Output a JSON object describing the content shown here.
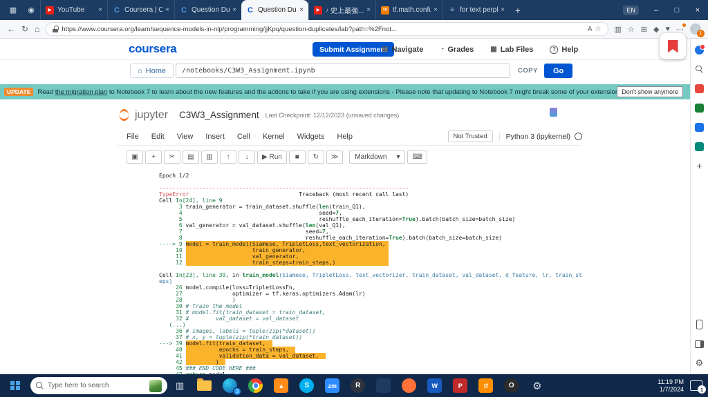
{
  "colors": {
    "accent_blue": "#0056d2",
    "jupyter_orange": "#f37726",
    "banner_teal": "#74cac3",
    "highlight_orange": "#fcb32c"
  },
  "browser": {
    "tab_actions_icon": "▦",
    "pinned_icon": "◉",
    "tabs": [
      {
        "label": "YouTube",
        "icon": "youtube"
      },
      {
        "label": "Coursera | Onli...",
        "icon": "coursera"
      },
      {
        "label": "Question Dupli...",
        "icon": "coursera"
      },
      {
        "label": "Question Dupli...",
        "icon": "coursera",
        "active": true
      },
      {
        "label": "史上最強...",
        "icon": "youtube",
        "audio": true
      },
      {
        "label": "tf.math.confusi...",
        "icon": "tensorflow"
      },
      {
        "label": "for text perplex...",
        "icon": "page"
      }
    ],
    "new_tab_label": "+",
    "language_badge": "EN",
    "minimize": "–",
    "maximize": "□",
    "close": "×",
    "back_icon": "←",
    "refresh_icon": "↻",
    "home_icon": "⌂",
    "url": "https://www.coursera.org/learn/sequence-models-in-nlp/programming/jjKpq/question-duplicates/lab?path=%2Fnot...",
    "read_aloud_icon": "A",
    "favorite_icon": "☆",
    "toolbar_icons": [
      {
        "n": "split-screen-icon",
        "g": "▥"
      },
      {
        "n": "favorites-icon",
        "g": "☆"
      },
      {
        "n": "collections-icon",
        "g": "⊞"
      },
      {
        "n": "extensions-icon",
        "g": "◆"
      },
      {
        "n": "browser-essentials-icon",
        "g": "♥"
      },
      {
        "n": "settings-more-icon",
        "g": "⋯",
        "dot": true
      }
    ],
    "profile_badge": "1"
  },
  "coursera": {
    "logo": "coursera",
    "submit": "Submit Assignment",
    "nav_items": [
      {
        "n": "navigate-button",
        "icon": "▤",
        "label": "Navigate"
      },
      {
        "n": "grades-button",
        "icon": "◔",
        "label": "Grades"
      },
      {
        "n": "lab-files-button",
        "icon": "▦",
        "label": "Lab Files"
      },
      {
        "n": "help-button",
        "icon": "?",
        "label": "Help",
        "qmark": true
      }
    ],
    "home": "Home",
    "home_icon": "⌂",
    "path": "/notebooks/C3W3_Assignment.ipynb",
    "copy": "COPY",
    "go": "Go"
  },
  "banner": {
    "badge": "UPDATE",
    "pre": "Read ",
    "link": "the migration plan",
    "post": " to Notebook 7 to learn about the new features and the actions to take if you are using extensions - Please note that updating to Notebook 7 might break some of your extensions.",
    "dismiss": "Don't show anymore"
  },
  "jupyter": {
    "brand": "jupyter",
    "title": "C3W3_Assignment",
    "checkpoint": "Last Checkpoint: 12/12/2023",
    "unsaved": "(unsaved changes)",
    "menus": [
      "File",
      "Edit",
      "View",
      "Insert",
      "Cell",
      "Kernel",
      "Widgets",
      "Help"
    ],
    "not_trusted": "Not Trusted",
    "kernel_name": "Python 3 (ipykernel)",
    "cell_type": "Markdown",
    "caret": "▾",
    "keyboard_icon": "⌨",
    "toolbar": [
      {
        "n": "save-button",
        "g": "▣"
      },
      {
        "n": "insert-cell-button",
        "g": "+"
      },
      {
        "n": "cut-cells-button",
        "g": "✂"
      },
      {
        "n": "copy-cells-button",
        "g": "▤"
      },
      {
        "n": "paste-cells-button",
        "g": "▥"
      },
      {
        "n": "move-cell-up-button",
        "g": "↑"
      },
      {
        "n": "move-cell-down-button",
        "g": "↓"
      },
      {
        "n": "run-button",
        "g": "▶ Run"
      },
      {
        "n": "interrupt-kernel-button",
        "g": "■"
      },
      {
        "n": "restart-kernel-button",
        "g": "↻"
      },
      {
        "n": "restart-run-all-button",
        "g": "≫"
      }
    ]
  },
  "code": {
    "lines": [
      {
        "s": [
          {
            "t": "Epoch 1/2",
            "c": "p"
          }
        ]
      },
      {
        "s": []
      },
      {
        "s": [
          {
            "t": "---------------------------------------------------------------------------",
            "c": "r"
          }
        ]
      },
      {
        "s": [
          {
            "t": "TypeError",
            "c": "r"
          },
          {
            "t": "                                 Traceback (most recent call last)",
            "c": "p"
          }
        ]
      },
      {
        "s": [
          {
            "t": "Cell ",
            "c": "p"
          },
          {
            "t": "In[24], line 9",
            "c": "g"
          }
        ]
      },
      {
        "s": [
          {
            "t": "      3 ",
            "c": "g"
          },
          {
            "t": "train_generator = train_dataset.shuffle(",
            "c": "p"
          },
          {
            "t": "len",
            "c": "k"
          },
          {
            "t": "(train_Q1),",
            "c": "p"
          }
        ]
      },
      {
        "s": [
          {
            "t": "      4 ",
            "c": "g"
          },
          {
            "t": "                                        seed=",
            "c": "p"
          },
          {
            "t": "7",
            "c": "k"
          },
          {
            "t": ",",
            "c": "p"
          }
        ]
      },
      {
        "s": [
          {
            "t": "      5 ",
            "c": "g"
          },
          {
            "t": "                                        reshuffle_each_iteration=",
            "c": "p"
          },
          {
            "t": "True",
            "c": "k"
          },
          {
            "t": ").batch(batch_size=batch_size)",
            "c": "p"
          }
        ]
      },
      {
        "s": [
          {
            "t": "      6 ",
            "c": "g"
          },
          {
            "t": "val_generator = val_dataset.shuffle(",
            "c": "p"
          },
          {
            "t": "len",
            "c": "k"
          },
          {
            "t": "(val_Q1),",
            "c": "p"
          }
        ]
      },
      {
        "s": [
          {
            "t": "      7 ",
            "c": "g"
          },
          {
            "t": "                                    seed=",
            "c": "p"
          },
          {
            "t": "7",
            "c": "k"
          },
          {
            "t": ",",
            "c": "p"
          }
        ]
      },
      {
        "s": [
          {
            "t": "      8 ",
            "c": "g"
          },
          {
            "t": "                                    reshuffle_each_iteration=",
            "c": "p"
          },
          {
            "t": "True",
            "c": "k"
          },
          {
            "t": ").batch(batch_size=batch_size)",
            "c": "p"
          }
        ]
      },
      {
        "s": [
          {
            "t": "----> 9 ",
            "c": "g"
          },
          {
            "t": "model = train_model(Siamese, TripletLoss,text_vectorization, ",
            "c": "h"
          }
        ]
      },
      {
        "s": [
          {
            "t": "     10 ",
            "c": "g"
          },
          {
            "t": "                    train_generator,                         ",
            "c": "h"
          }
        ]
      },
      {
        "s": [
          {
            "t": "     11 ",
            "c": "g"
          },
          {
            "t": "                    val_generator,                           ",
            "c": "h"
          }
        ]
      },
      {
        "s": [
          {
            "t": "     12 ",
            "c": "g"
          },
          {
            "t": "                    train_steps=train_steps,)                ",
            "c": "h"
          }
        ]
      },
      {
        "s": []
      },
      {
        "s": [
          {
            "t": "Cell ",
            "c": "p"
          },
          {
            "t": "In[23], line 39",
            "c": "g"
          },
          {
            "t": ", in ",
            "c": "p"
          },
          {
            "t": "train_model",
            "c": "k"
          },
          {
            "t": "(Siamese, TripletLoss, text_vectorizer, train_dataset, val_dataset, d_feature, lr, train_st",
            "c": "sig"
          }
        ]
      },
      {
        "s": [
          {
            "t": "eps)",
            "c": "sig"
          }
        ]
      },
      {
        "s": [
          {
            "t": "     26 ",
            "c": "g"
          },
          {
            "t": "model.compile(loss=TripletLossFn,",
            "c": "p"
          }
        ]
      },
      {
        "s": [
          {
            "t": "     27 ",
            "c": "g"
          },
          {
            "t": "              optimizer = tf.keras.optimizers.Adam(lr)",
            "c": "p"
          }
        ]
      },
      {
        "s": [
          {
            "t": "     28 ",
            "c": "g"
          },
          {
            "t": "              )",
            "c": "p"
          }
        ]
      },
      {
        "s": [
          {
            "t": "     30 ",
            "c": "g"
          },
          {
            "t": "# Train the model",
            "c": "t"
          }
        ]
      },
      {
        "s": [
          {
            "t": "     31 ",
            "c": "g"
          },
          {
            "t": "# model.fit(train_dataset = train_dataset,",
            "c": "t"
          }
        ]
      },
      {
        "s": [
          {
            "t": "     32 ",
            "c": "g"
          },
          {
            "t": "#        val_dataset = val_dataset",
            "c": "t"
          }
        ]
      },
      {
        "s": [
          {
            "t": "   (...)",
            "c": "g"
          }
        ]
      },
      {
        "s": [
          {
            "t": "     36 ",
            "c": "g"
          },
          {
            "t": "# images, labels = tuple(zip(*dataset))",
            "c": "t"
          }
        ]
      },
      {
        "s": [
          {
            "t": "     37 ",
            "c": "g"
          },
          {
            "t": "# x, y = tuple(zip(*train_dataset))",
            "c": "t"
          }
        ]
      },
      {
        "s": [
          {
            "t": "---> 39 ",
            "c": "g"
          },
          {
            "t": "model.fit(train_dataset,  ",
            "c": "h"
          }
        ]
      },
      {
        "s": [
          {
            "t": "     40 ",
            "c": "g"
          },
          {
            "t": "          epochs = train_steps,  ",
            "c": "h"
          }
        ]
      },
      {
        "s": [
          {
            "t": "     41 ",
            "c": "g"
          },
          {
            "t": "          validation_data = val_dataset,  ",
            "c": "h"
          }
        ]
      },
      {
        "s": [
          {
            "t": "     42 ",
            "c": "g"
          },
          {
            "t": "         )  ",
            "c": "h"
          }
        ]
      },
      {
        "s": [
          {
            "t": "     45 ",
            "c": "g"
          },
          {
            "t": "### END CODE HERE ###",
            "c": "t"
          }
        ]
      },
      {
        "s": [
          {
            "t": "     47 ",
            "c": "g"
          },
          {
            "t": "return",
            "c": "k"
          },
          {
            "t": " model",
            "c": "p"
          }
        ]
      }
    ]
  },
  "edge_sidebar": {
    "items": [
      {
        "name": "copilot",
        "type": "bell"
      },
      {
        "name": "sidebar-search",
        "type": "mag"
      },
      {
        "name": "shopping",
        "type": "sq",
        "color": "#e8453c"
      },
      {
        "name": "microsoft365",
        "type": "sq",
        "color": "#188038"
      },
      {
        "name": "outlook",
        "type": "sq",
        "color": "#1a73e8"
      },
      {
        "name": "drop",
        "type": "sq",
        "color": "#00897b"
      },
      {
        "name": "add-sidebar-app",
        "type": "plus"
      },
      {
        "name": "phone-link",
        "type": "phone",
        "bottom": true
      },
      {
        "name": "sidebar-panel",
        "type": "panel"
      },
      {
        "name": "sidebar-settings",
        "type": "gear"
      }
    ]
  },
  "taskbar": {
    "search_placeholder": "Type here to search",
    "taskview_icon": "▥",
    "time": "11:19 PM",
    "date": "1/7/2024",
    "tray_badge": "1",
    "apps": [
      {
        "name": "file-explorer",
        "type": "folder"
      },
      {
        "name": "edge-browser",
        "type": "circle",
        "grad": "edge",
        "badge": "3"
      },
      {
        "name": "chrome-browser",
        "type": "chrome"
      },
      {
        "name": "vlc-media",
        "type": "square",
        "bg": "#ff8c1a",
        "label": "▲"
      },
      {
        "name": "skype",
        "type": "circle",
        "bg": "#00aff0",
        "label": "S"
      },
      {
        "name": "zoom",
        "type": "square",
        "bg": "#2d8cff",
        "label": "zm"
      },
      {
        "name": "r-app",
        "type": "circle",
        "bg": "#30343c",
        "label": "R"
      },
      {
        "name": "code-editor",
        "type": "square",
        "bg": "#1f3a5f",
        "label": ""
      },
      {
        "name": "firefox-browser",
        "type": "circle",
        "bg": "#ff7139",
        "label": ""
      },
      {
        "name": "word",
        "type": "square",
        "bg": "#185abd",
        "label": "W"
      },
      {
        "name": "acrobat",
        "type": "square",
        "bg": "#c12a2a",
        "label": "P"
      },
      {
        "name": "tensorflow-app",
        "type": "square",
        "bg": "#ff8f00",
        "label": "tf"
      },
      {
        "name": "opera-browser",
        "type": "circle",
        "bg": "#2b2b2b",
        "label": "O"
      },
      {
        "name": "windows-settings",
        "type": "gear"
      }
    ]
  }
}
